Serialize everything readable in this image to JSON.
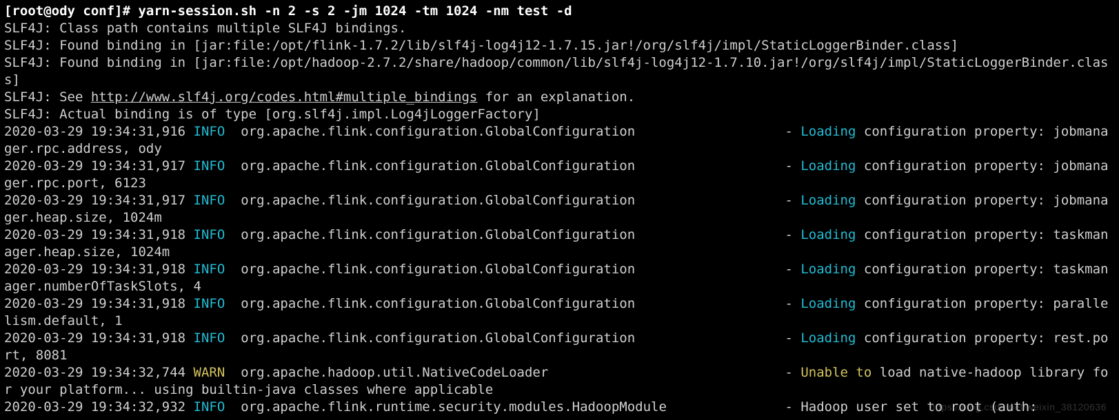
{
  "prompt": {
    "prefix": "[root@ody conf]# ",
    "command": "yarn-session.sh -n 2 -s 2 -jm 1024 -tm 1024 -nm test -d"
  },
  "slf4j": {
    "l1": "SLF4J: Class path contains multiple SLF4J bindings.",
    "l2": "SLF4J: Found binding in [jar:file:/opt/flink-1.7.2/lib/slf4j-log4j12-1.7.15.jar!/org/slf4j/impl/StaticLoggerBinder.class]",
    "l3": "SLF4J: Found binding in [jar:file:/opt/hadoop-2.7.2/share/hadoop/common/lib/slf4j-log4j12-1.7.10.jar!/org/slf4j/impl/StaticLoggerBinder.class]",
    "l4_a": "SLF4J: See ",
    "l4_link": "http://www.slf4j.org/codes.html#multiple_bindings",
    "l4_b": " for an explanation.",
    "l5": "SLF4J: Actual binding is of type [org.slf4j.impl.Log4jLoggerFactory]"
  },
  "logs": [
    {
      "ts": "2020-03-29 19:34:31,916",
      "level": "INFO",
      "logger": "org.apache.flink.configuration.GlobalConfiguration",
      "hl": "Loading",
      "msg_rest": " configuration property: jobmanager.rpc.address, ody"
    },
    {
      "ts": "2020-03-29 19:34:31,917",
      "level": "INFO",
      "logger": "org.apache.flink.configuration.GlobalConfiguration",
      "hl": "Loading",
      "msg_rest": " configuration property: jobmanager.rpc.port, 6123"
    },
    {
      "ts": "2020-03-29 19:34:31,917",
      "level": "INFO",
      "logger": "org.apache.flink.configuration.GlobalConfiguration",
      "hl": "Loading",
      "msg_rest": " configuration property: jobmanager.heap.size, 1024m"
    },
    {
      "ts": "2020-03-29 19:34:31,918",
      "level": "INFO",
      "logger": "org.apache.flink.configuration.GlobalConfiguration",
      "hl": "Loading",
      "msg_rest": " configuration property: taskmanager.heap.size, 1024m"
    },
    {
      "ts": "2020-03-29 19:34:31,918",
      "level": "INFO",
      "logger": "org.apache.flink.configuration.GlobalConfiguration",
      "hl": "Loading",
      "msg_rest": " configuration property: taskmanager.numberOfTaskSlots, 4"
    },
    {
      "ts": "2020-03-29 19:34:31,918",
      "level": "INFO",
      "logger": "org.apache.flink.configuration.GlobalConfiguration",
      "hl": "Loading",
      "msg_rest": " configuration property: parallelism.default, 1"
    },
    {
      "ts": "2020-03-29 19:34:31,918",
      "level": "INFO",
      "logger": "org.apache.flink.configuration.GlobalConfiguration",
      "hl": "Loading",
      "msg_rest": " configuration property: rest.port, 8081"
    },
    {
      "ts": "2020-03-29 19:34:32,744",
      "level": "WARN",
      "logger": "org.apache.hadoop.util.NativeCodeLoader",
      "hl": "Unable to",
      "msg_rest": " load native-hadoop library for your platform... using builtin-java classes where applicable"
    },
    {
      "ts": "2020-03-29 19:34:32,932",
      "level": "INFO",
      "logger": "org.apache.flink.runtime.security.modules.HadoopModule",
      "hl": "",
      "msg_rest": "Hadoop user set to root (auth:"
    }
  ],
  "cols": {
    "ts_width": 24,
    "level_width": 6,
    "logger_width": 69
  },
  "watermark": "https://blog.csdn.net/weixin_38120636"
}
